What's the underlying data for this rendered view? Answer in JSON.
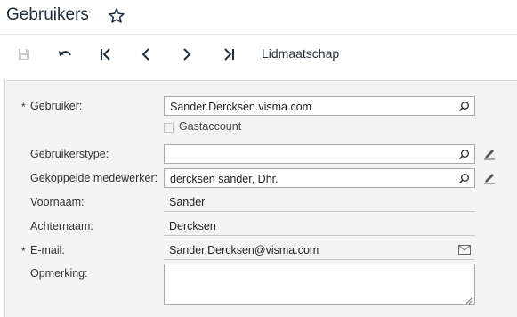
{
  "header": {
    "title": "Gebruikers",
    "favorite_icon": "star-outline-icon"
  },
  "toolbar": {
    "items": [
      {
        "icon": "save-icon",
        "disabled": true
      },
      {
        "icon": "undo-icon"
      },
      {
        "icon": "first-record-icon"
      },
      {
        "icon": "previous-record-icon"
      },
      {
        "icon": "next-record-icon"
      },
      {
        "icon": "last-record-icon"
      }
    ],
    "membership_label": "Lidmaatschap"
  },
  "form": {
    "required_marker": "*",
    "user": {
      "label": "Gebruiker:",
      "value": "Sander.Dercksen.visma.com",
      "required": true
    },
    "guest_account": {
      "label": "Gastaccount",
      "checked": false
    },
    "user_type": {
      "label": "Gebruikerstype:",
      "value": ""
    },
    "linked_employee": {
      "label": "Gekoppelde medewerker:",
      "value": "dercksen sander, Dhr."
    },
    "first_name": {
      "label": "Voornaam:",
      "value": "Sander"
    },
    "last_name": {
      "label": "Achternaam:",
      "value": "Dercksen"
    },
    "email": {
      "label": "E-mail:",
      "value": "Sander.Dercksen@visma.com",
      "required": true
    },
    "remark": {
      "label": "Opmerking:",
      "value": ""
    }
  },
  "colors": {
    "text_dark": "#1f2d3d",
    "icon_gray": "#555555",
    "panel_bg": "#f4f4f4"
  }
}
